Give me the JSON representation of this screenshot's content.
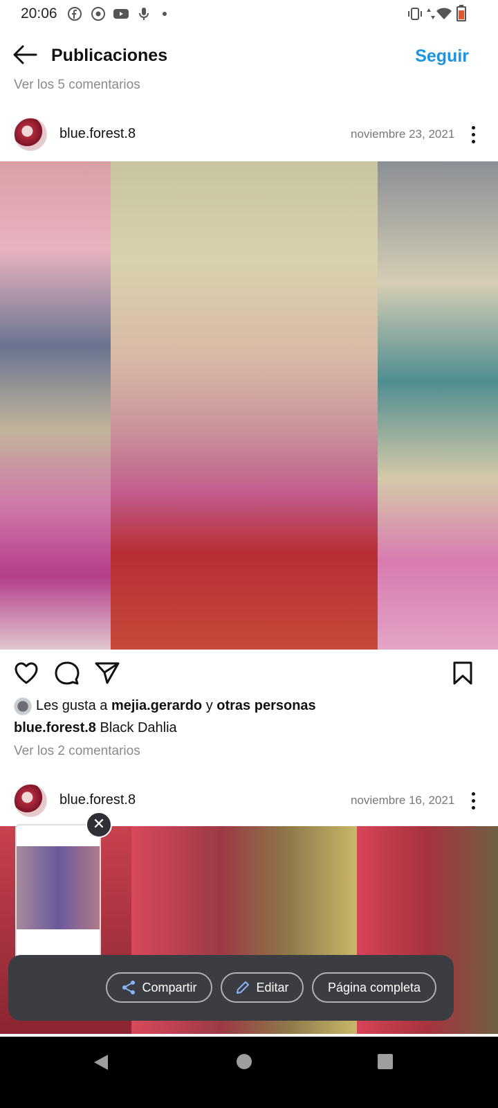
{
  "status_bar": {
    "time": "20:06",
    "left_icons": [
      "facebook-icon",
      "chrome-icon",
      "youtube-icon",
      "mic-icon",
      "dot-icon"
    ],
    "right_icons": [
      "vibrate-icon",
      "data-arrows-icon",
      "wifi-icon",
      "battery-icon"
    ]
  },
  "header": {
    "title": "Publicaciones",
    "follow_label": "Seguir"
  },
  "prev_post": {
    "comments_link": "Ver los 5 comentarios"
  },
  "post1": {
    "username": "blue.forest.8",
    "date": "noviembre 23, 2021",
    "likes_prefix": "Les gusta a ",
    "likes_user": "mejia.gerardo",
    "likes_middle": " y ",
    "likes_others": "otras personas",
    "caption_user": "blue.forest.8",
    "caption_text": " Black Dahlia",
    "comments_link": "Ver los 2 comentarios"
  },
  "post2": {
    "username": "blue.forest.8",
    "date": "noviembre 16, 2021"
  },
  "share_sheet": {
    "share_label": "Compartir",
    "edit_label": "Editar",
    "fullpage_label": "Página completa",
    "close_symbol": "✕"
  },
  "colors": {
    "accent": "#1b95e0",
    "sheet_bg": "#3b3d42",
    "navbar_bg": "#000000"
  }
}
